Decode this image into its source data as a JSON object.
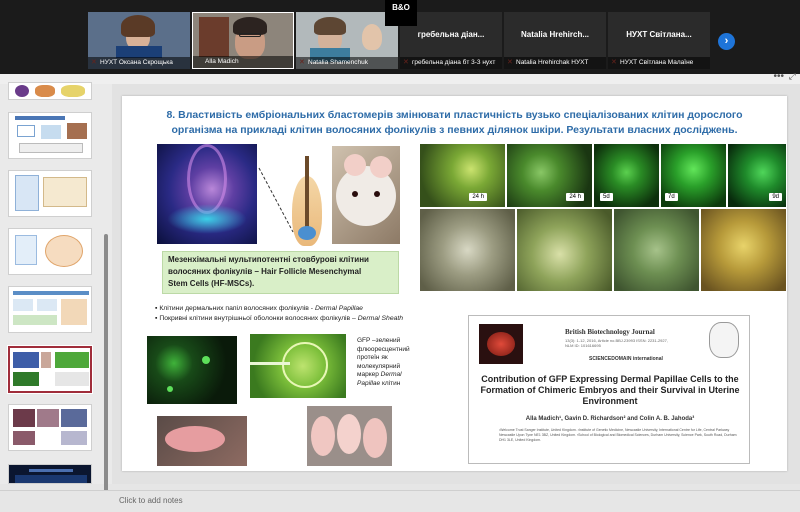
{
  "participants": [
    {
      "name": "НУХТ Оксана Скрощька"
    },
    {
      "name": "Alla Madich"
    },
    {
      "name": "Natalia Shamenchuk"
    },
    {
      "name": "гребельна діан...",
      "caption": "гребельна діана бт 3-3 нухт"
    },
    {
      "name": "Natalia Hrehirch...",
      "caption": "Natalia Hrehirchak НУХТ"
    },
    {
      "name": "НУХТ Світлана...",
      "caption": "НУХТ Світлана Малаїне"
    }
  ],
  "logo_text": "B&O",
  "icons": {
    "next": "chevron-right-icon",
    "more": "more-options-icon",
    "mic_off": "mic-off-icon"
  },
  "slide": {
    "title_line1": "8. Властивість ембріональних бластомерів змінювати пластичність вузько спеціалізованих клітин дорослого",
    "title_line2": "організма на прикладі клітин волосяних фолікулів з певних ділянок шкіри.  Результати власних досліджень.",
    "hf_box_line1": "Мезенхімальні мультипотентні стовбурові клітини",
    "hf_box_line2": "волосяних фолікулів – Hair Follicle Mesenchymal",
    "hf_box_line3": "Stem Cells (HF-MSCs).",
    "bullet1_text": "Клітини дермальних папіл волосяних фолікулів - ",
    "bullet1_italic": "Dermal Papillae",
    "bullet2_text": "Покривні клітини внутрішньої оболонки волосяних фолікулів  – ",
    "bullet2_italic": "Dermal Sheath",
    "gfp_text": "GFP –зелений флюоресцентний протеїн як молекулярний маркер",
    "gfp_italic": "Dermal Papillae",
    "gfp_suffix": "клітин",
    "time_labels": [
      "24 h",
      "24 h",
      "5d",
      "7d",
      "9d"
    ],
    "paper": {
      "journal": "British Biotechnology Journal",
      "meta": "13(3): 1-12, 2016, Article no.BBJ.23993  ISSN: 2231-2927, NLM ID: 101616695",
      "publisher": "SCIENCEDOMAIN international",
      "title": "Contribution of GFP Expressing Dermal Papillae Cells to the Formation of Chimeric Embryos and their Survival in Uterine Environment",
      "authors": "Alla Madich¹, Gavin D. Richardson² and Colin A. B. Jahoda³",
      "affiliations": "¹Welcome Trust Sanger Institute, United Kingdom. ²Institute of Genetic Medicine, Newcastle University, International Centre for Life, Central Parkway Newcastle Upon Tyne NE1 3BZ, United Kingdom. ³School of Biological and Biomedical Sciences, Durham University, Science Park, South Road, Durham DH1 3LE, United Kingdom."
    }
  },
  "notes_placeholder": "Click to add notes"
}
